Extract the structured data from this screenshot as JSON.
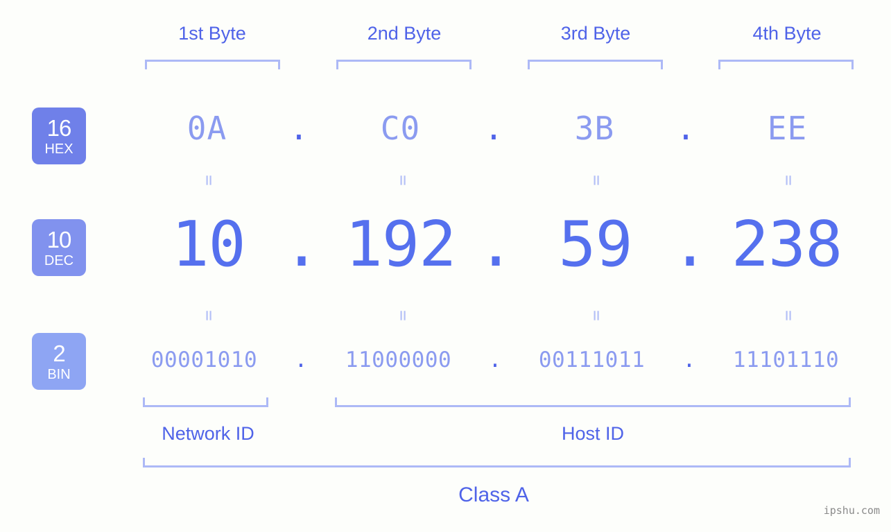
{
  "meta": {
    "watermark": "ipshu.com",
    "accent_dark": "#4f63e8",
    "accent_mid": "#5570ee",
    "accent_light": "#8b9bf0",
    "bracket_color": "#adb9f6",
    "background": "#fdfefb"
  },
  "byte_headers": [
    {
      "label": "1st Byte"
    },
    {
      "label": "2nd Byte"
    },
    {
      "label": "3rd Byte"
    },
    {
      "label": "4th Byte"
    }
  ],
  "bases": [
    {
      "number": "16",
      "unit": "HEX",
      "color": "#6f80e9"
    },
    {
      "number": "10",
      "unit": "DEC",
      "color": "#8192ee"
    },
    {
      "number": "2",
      "unit": "BIN",
      "color": "#8ea5f3"
    }
  ],
  "rows": {
    "hex": {
      "values": [
        "0A",
        "C0",
        "3B",
        "EE"
      ],
      "separator": "."
    },
    "dec": {
      "values": [
        "10",
        "192",
        "59",
        "238"
      ],
      "separator": "."
    },
    "bin": {
      "values": [
        "00001010",
        "11000000",
        "00111011",
        "11101110"
      ],
      "separator": "."
    }
  },
  "equals_symbol": "=",
  "sections": [
    {
      "label": "Network ID"
    },
    {
      "label": "Host ID"
    }
  ],
  "class": {
    "label": "Class A"
  },
  "address": {
    "dotted_decimal": "10.192.59.238",
    "dotted_hex": "0A.C0.3B.EE",
    "dotted_binary": "00001010.11000000.00111011.11101110"
  }
}
